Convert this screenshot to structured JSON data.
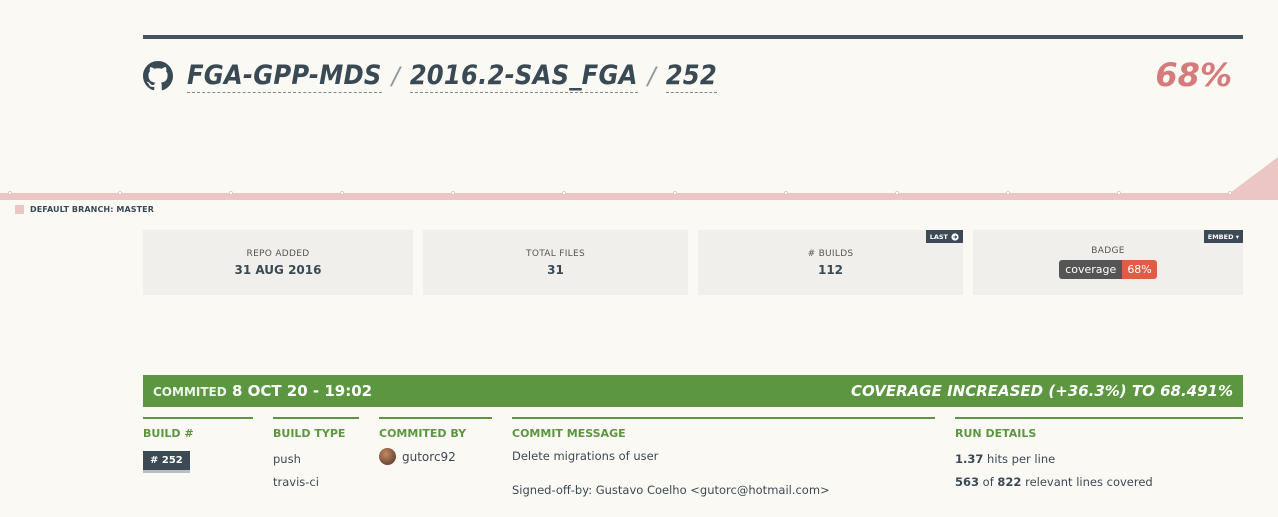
{
  "repo": {
    "org": "FGA-GPP-MDS",
    "name": "2016.2-SAS_FGA",
    "build": "252",
    "separator": "/",
    "coverage": "68%"
  },
  "legend": {
    "default_branch": "DEFAULT BRANCH: MASTER"
  },
  "stats": {
    "repo_added": {
      "label": "REPO ADDED",
      "value": "31 AUG 2016"
    },
    "total_files": {
      "label": "TOTAL FILES",
      "value": "31"
    },
    "builds": {
      "label": "# BUILDS",
      "value": "112",
      "button": "LAST"
    },
    "badge": {
      "label": "BADGE",
      "left": "coverage",
      "right": "68%",
      "button": "EMBED ▾"
    }
  },
  "build_bar": {
    "prefix": "COMMITED",
    "time": "8 OCT 20 - 19:02",
    "coverage_change": "COVERAGE INCREASED (+36.3%) TO 68.491%"
  },
  "details": {
    "build_num": {
      "header": "BUILD #",
      "value": "# 252"
    },
    "build_type": {
      "header": "BUILD TYPE",
      "values": [
        "push",
        "travis-ci"
      ]
    },
    "committed_by": {
      "header": "COMMITED BY",
      "user": "gutorc92"
    },
    "commit_message": {
      "header": "COMMIT MESSAGE",
      "line1": "Delete migrations of user",
      "line2": "Signed-off-by: Gustavo Coelho <gutorc@hotmail.com>"
    },
    "run_details": {
      "header": "RUN DETAILS",
      "hits": "1.37",
      "hits_label": "hits per line",
      "covered": "563",
      "of": "of",
      "relevant": "822",
      "relevant_label": "relevant lines covered"
    }
  },
  "colors": {
    "accent_green": "#5c9641",
    "coverage_red": "#d57b7b",
    "chart_fill": "#ecc6c4",
    "dark": "#3b4a55"
  }
}
